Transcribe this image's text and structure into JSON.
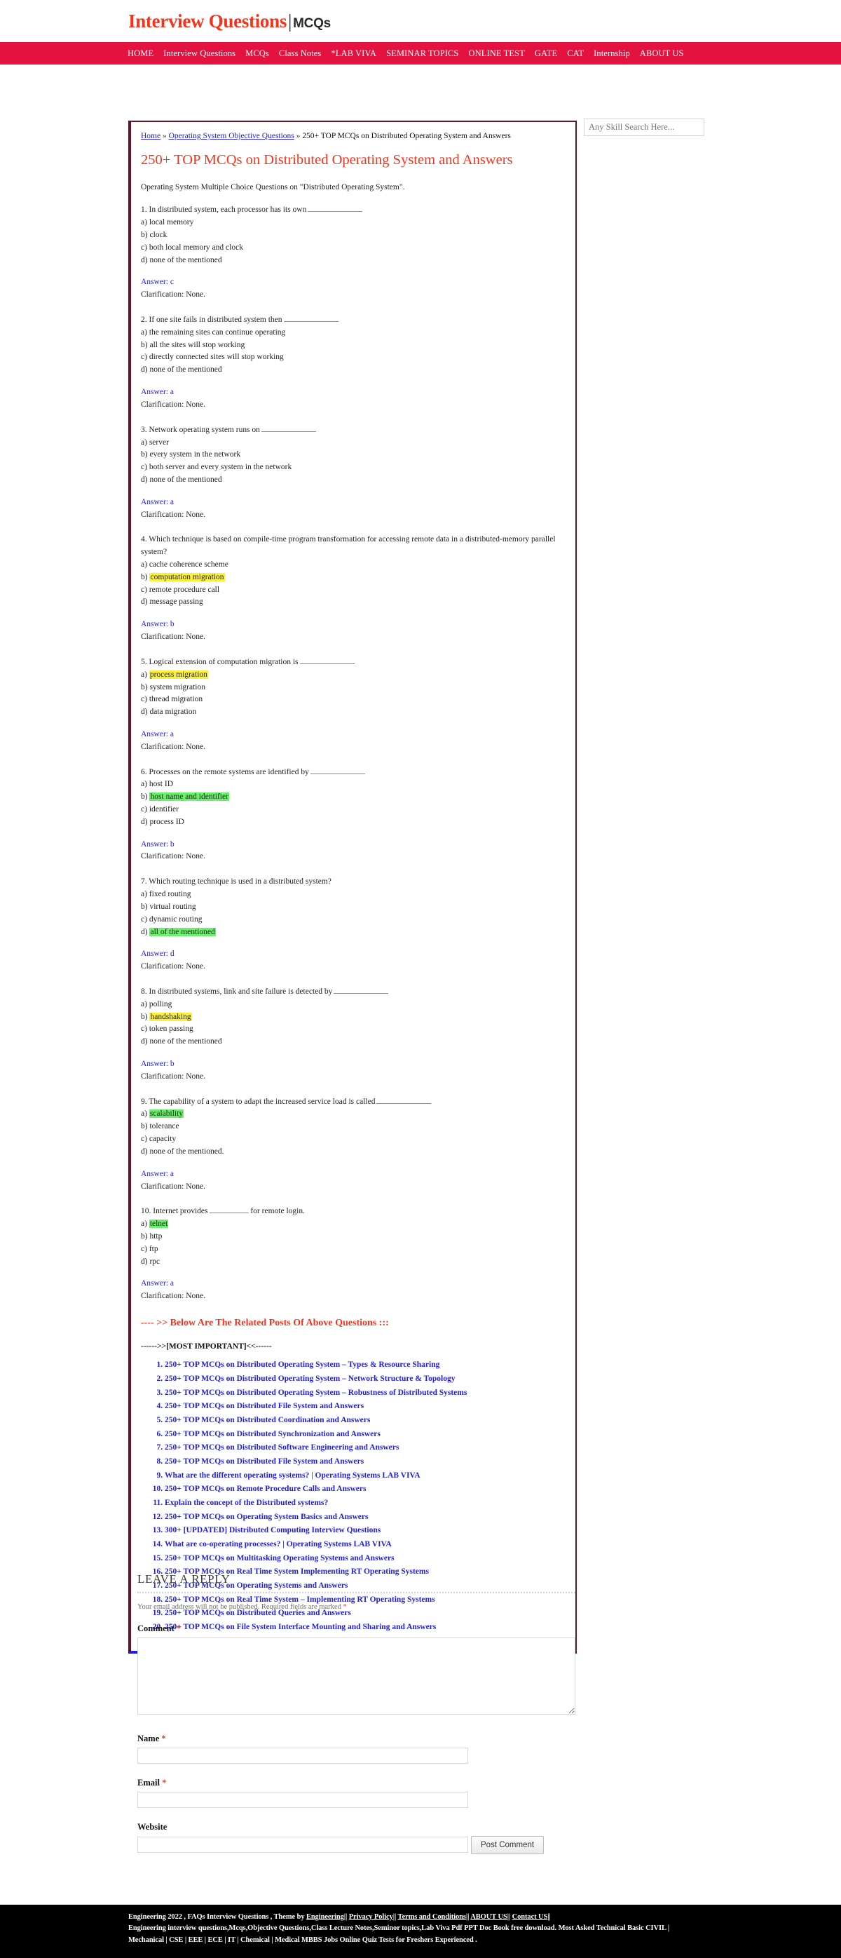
{
  "site": {
    "brand_main": "Interview Questions",
    "brand_separator": "|",
    "brand_sub": "MCQs",
    "nav_items": [
      "HOME",
      "Interview Questions",
      "MCQs",
      "Class Notes",
      "*LAB VIVA",
      "SEMINAR TOPICS",
      "ONLINE TEST",
      "GATE",
      "CAT",
      "Internship",
      "ABOUT US"
    ],
    "colors": {
      "nav_background": "#E4123E",
      "brand_red": "#F4341C",
      "link_blue": "#2020E0",
      "box_border": "#5E1622",
      "box_bottom_border": "#1C1CEE",
      "highlight_yellow": "#FBF13C",
      "highlight_green": "#6BF06B",
      "footer_background": "#000000"
    }
  },
  "search": {
    "placeholder": "Any Skill Search Here...",
    "value": ""
  },
  "breadcrumb": {
    "home": "Home",
    "sep": "»",
    "category": "Operating System Objective Questions",
    "current": "250+ TOP MCQs on Distributed Operating System and Answers"
  },
  "article": {
    "title": "250+ TOP MCQs on Distributed Operating System and Answers",
    "intro": "Operating System Multiple Choice Questions on \"Distributed Operating System\".",
    "answer_prefix": "Answer:",
    "clarification_text": "Clarification: None.",
    "questions": [
      {
        "number": "1.",
        "text": "In distributed system, each processor has its own",
        "blank": true,
        "options": [
          {
            "label": "a)",
            "text": "local memory",
            "highlight": "none"
          },
          {
            "label": "b)",
            "text": "clock",
            "highlight": "none"
          },
          {
            "label": "c)",
            "text": "both local memory and clock",
            "highlight": "none"
          },
          {
            "label": "d)",
            "text": "none of the mentioned",
            "highlight": "none"
          }
        ],
        "answer": "c"
      },
      {
        "number": "2.",
        "text": "If one site fails in distributed system then",
        "blank": true,
        "options": [
          {
            "label": "a)",
            "text": "the remaining sites can continue operating",
            "highlight": "none"
          },
          {
            "label": "b)",
            "text": "all the sites will stop working",
            "highlight": "none"
          },
          {
            "label": "c)",
            "text": "directly connected sites will stop working",
            "highlight": "none"
          },
          {
            "label": "d)",
            "text": "none of the mentioned",
            "highlight": "none"
          }
        ],
        "answer": "a"
      },
      {
        "number": "3.",
        "text": "Network operating system runs on",
        "blank": true,
        "options": [
          {
            "label": "a)",
            "text": "server",
            "highlight": "none"
          },
          {
            "label": "b)",
            "text": "every system in the network",
            "highlight": "none"
          },
          {
            "label": "c)",
            "text": "both server and every system in the network",
            "highlight": "none"
          },
          {
            "label": "d)",
            "text": "none of the mentioned",
            "highlight": "none"
          }
        ],
        "answer": "a"
      },
      {
        "number": "4.",
        "text": "Which technique is based on compile-time program transformation for accessing remote data in a distributed-memory parallel system?",
        "blank": false,
        "options": [
          {
            "label": "a)",
            "text": "cache coherence scheme",
            "highlight": "none"
          },
          {
            "label": "b)",
            "text": "computation migration",
            "highlight": "yellow"
          },
          {
            "label": "c)",
            "text": "remote procedure call",
            "highlight": "none"
          },
          {
            "label": "d)",
            "text": "message passing",
            "highlight": "none"
          }
        ],
        "answer": "b"
      },
      {
        "number": "5.",
        "text": "Logical extension of computation migration is",
        "blank": true,
        "options": [
          {
            "label": "a)",
            "text": "process migration",
            "highlight": "yellow"
          },
          {
            "label": "b)",
            "text": "system migration",
            "highlight": "none"
          },
          {
            "label": "c)",
            "text": "thread migration",
            "highlight": "none"
          },
          {
            "label": "d)",
            "text": "data migration",
            "highlight": "none"
          }
        ],
        "answer": "a"
      },
      {
        "number": "6.",
        "text": "Processes on the remote systems are identified by",
        "blank": true,
        "options": [
          {
            "label": "a)",
            "text": "host ID",
            "highlight": "none"
          },
          {
            "label": "b)",
            "text": "host name and identifier",
            "highlight": "green"
          },
          {
            "label": "c)",
            "text": "identifier",
            "highlight": "none"
          },
          {
            "label": "d)",
            "text": "process ID",
            "highlight": "none"
          }
        ],
        "answer": "b"
      },
      {
        "number": "7.",
        "text": "Which routing technique is used in a distributed system?",
        "blank": false,
        "options": [
          {
            "label": "a)",
            "text": "fixed routing",
            "highlight": "none"
          },
          {
            "label": "b)",
            "text": "virtual routing",
            "highlight": "none"
          },
          {
            "label": "c)",
            "text": "dynamic routing",
            "highlight": "none"
          },
          {
            "label": "d)",
            "text": "all of the mentioned",
            "highlight": "green"
          }
        ],
        "answer": "d"
      },
      {
        "number": "8.",
        "text": "In distributed systems, link and site failure is detected by",
        "blank": true,
        "options": [
          {
            "label": "a)",
            "text": "polling",
            "highlight": "none"
          },
          {
            "label": "b)",
            "text": "handshaking",
            "highlight": "yellow"
          },
          {
            "label": "c)",
            "text": "token passing",
            "highlight": "none"
          },
          {
            "label": "d)",
            "text": "none of the mentioned",
            "highlight": "none"
          }
        ],
        "answer": "b"
      },
      {
        "number": "9.",
        "text": "The capability of a system to adapt the increased service load is called",
        "blank": true,
        "options": [
          {
            "label": "a)",
            "text": "scalability",
            "highlight": "green"
          },
          {
            "label": "b)",
            "text": "tolerance",
            "highlight": "none"
          },
          {
            "label": "c)",
            "text": "capacity",
            "highlight": "none"
          },
          {
            "label": "d)",
            "text": "none of the mentioned.",
            "highlight": "none"
          }
        ],
        "answer": "a"
      },
      {
        "number": "10.",
        "text": "Internet provides",
        "blank": true,
        "text_after": "for remote login.",
        "options": [
          {
            "label": "a)",
            "text": "telnet",
            "highlight": "green"
          },
          {
            "label": "b)",
            "text": "http",
            "highlight": "none"
          },
          {
            "label": "c)",
            "text": "ftp",
            "highlight": "none"
          },
          {
            "label": "d)",
            "text": "rpc",
            "highlight": "none"
          }
        ],
        "answer": "a"
      }
    ]
  },
  "related": {
    "heading": "---- >> Below Are The Related Posts Of Above Questions :::",
    "most_important": "------>>[MOST IMPORTANT]<<------",
    "items": [
      "250+ TOP MCQs on Distributed Operating System – Types & Resource Sharing",
      "250+ TOP MCQs on Distributed Operating System – Network Structure & Topology",
      "250+ TOP MCQs on Distributed Operating System – Robustness of Distributed Systems",
      "250+ TOP MCQs on Distributed File System and Answers",
      "250+ TOP MCQs on Distributed Coordination and Answers",
      "250+ TOP MCQs on Distributed Synchronization and Answers",
      "250+ TOP MCQs on Distributed Software Engineering and Answers",
      "250+ TOP MCQs on Distributed File System and Answers",
      "What are the different operating systems? | Operating Systems LAB VIVA",
      "250+ TOP MCQs on Remote Procedure Calls and Answers",
      "Explain the concept of the Distributed systems?",
      "250+ TOP MCQs on Operating System Basics and Answers",
      "300+ [UPDATED] Distributed Computing Interview Questions",
      "What are co-operating processes? | Operating Systems LAB VIVA",
      "250+ TOP MCQs on Multitasking Operating Systems and Answers",
      "250+ TOP MCQs on Real Time System Implementing RT Operating Systems",
      "250+ TOP MCQs on Operating Systems and Answers",
      "250+ TOP MCQs on Real Time System – Implementing RT Operating Systems",
      "250+ TOP MCQs on Distributed Queries and Answers",
      "250+ TOP MCQs on File System Interface Mounting and Sharing and Answers"
    ]
  },
  "comment_form": {
    "title": "LEAVE A REPLY",
    "notice": "Your email address will not be published. Required fields are marked",
    "required_mark": "*",
    "comment_label": "Comment",
    "comment_value": "",
    "name_label": "Name",
    "name_value": "",
    "email_label": "Email",
    "email_value": "",
    "website_label": "Website",
    "website_value": "",
    "submit_label": "Post Comment"
  },
  "footer": {
    "line1_prefix": "Engineering 2022 , FAQs Interview Questions , Theme by ",
    "line1_links": [
      "Engineering",
      "Privacy Policy",
      "Terms and Conditions",
      "ABOUT US",
      "Contact US"
    ],
    "line2": "Engineering interview questions,Mcqs,Objective Questions,Class Lecture Notes,Seminor topics,Lab Viva Pdf PPT Doc Book free download. Most Asked Technical Basic CIVIL |",
    "line3": "Mechanical | CSE | EEE | ECE | IT | Chemical | Medical MBBS Jobs Online Quiz Tests for Freshers Experienced ."
  }
}
